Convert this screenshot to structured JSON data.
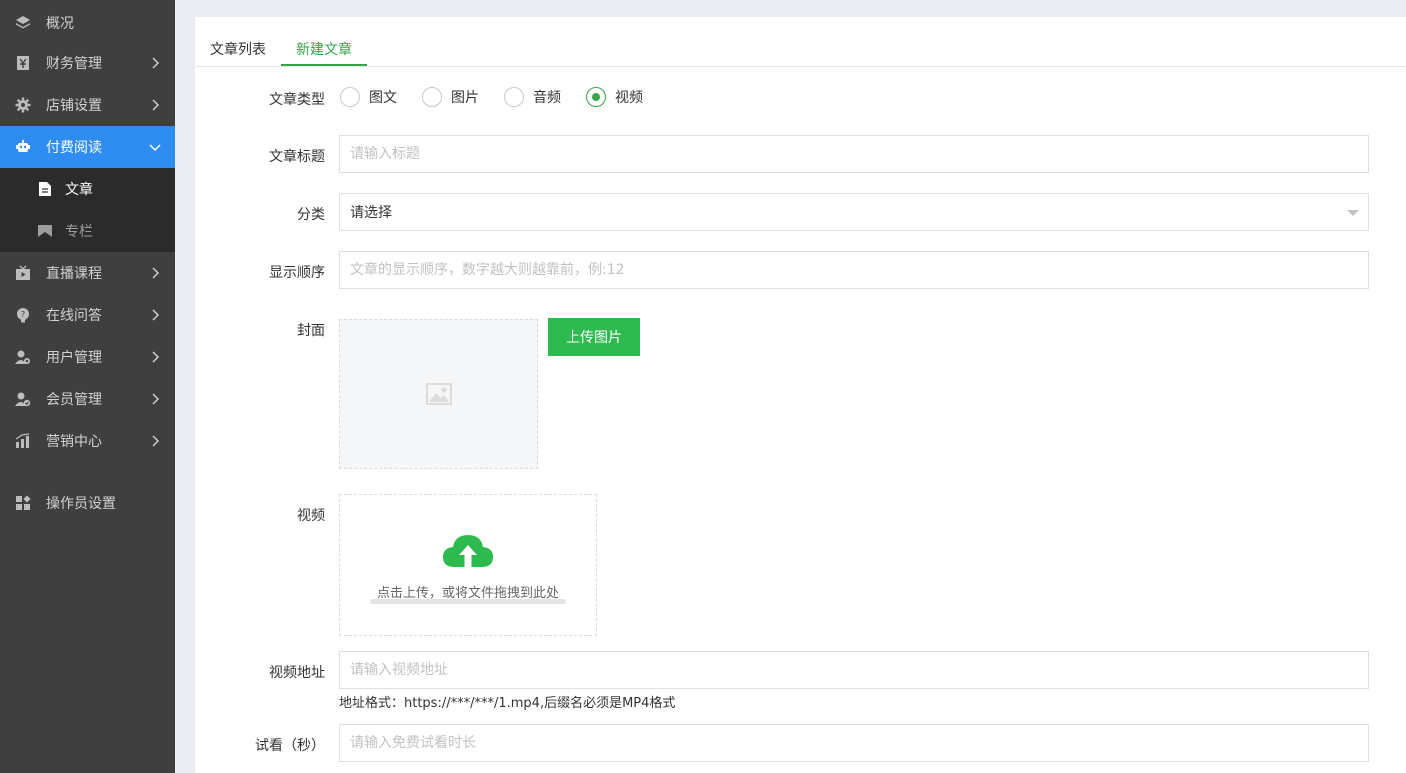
{
  "sidebar": {
    "items": [
      {
        "label": "概况",
        "icon": "layers-icon"
      },
      {
        "label": "财务管理",
        "icon": "finance-icon"
      },
      {
        "label": "店铺设置",
        "icon": "gear-icon"
      },
      {
        "label": "付费阅读",
        "icon": "reading-icon"
      },
      {
        "label": "直播课程",
        "icon": "live-icon"
      },
      {
        "label": "在线问答",
        "icon": "question-icon"
      },
      {
        "label": "用户管理",
        "icon": "user-icon"
      },
      {
        "label": "会员管理",
        "icon": "member-icon"
      },
      {
        "label": "营销中心",
        "icon": "chart-icon"
      },
      {
        "label": "操作员设置",
        "icon": "operator-icon"
      }
    ],
    "sub_items": [
      {
        "label": "文章",
        "icon": "document-icon"
      },
      {
        "label": "专栏",
        "icon": "column-icon"
      }
    ],
    "accent": "#2f8cf0"
  },
  "tabs": [
    {
      "label": "文章列表"
    },
    {
      "label": "新建文章"
    }
  ],
  "form": {
    "type_label": "文章类型",
    "type_options": [
      "图文",
      "图片",
      "音频",
      "视频"
    ],
    "type_selected": "视频",
    "title_label": "文章标题",
    "title_placeholder": "请输入标题",
    "category_label": "分类",
    "category_value": "请选择",
    "order_label": "显示顺序",
    "order_placeholder": "文章的显示顺序，数字越大则越靠前，例:12",
    "cover_label": "封面",
    "upload_button": "上传图片",
    "video_label": "视频",
    "video_hint": "点击上传，或将文件拖拽到此处",
    "video_url_label": "视频地址",
    "video_url_placeholder": "请输入视频地址",
    "video_url_note": "地址格式：https://***/***/1.mp4,后缀名必须是MP4格式",
    "trial_label": "试看（秒）",
    "trial_placeholder": "请输入免费试看时长"
  },
  "colors": {
    "green": "#2fba4f",
    "sidebar_bg": "#3f3f3f"
  }
}
